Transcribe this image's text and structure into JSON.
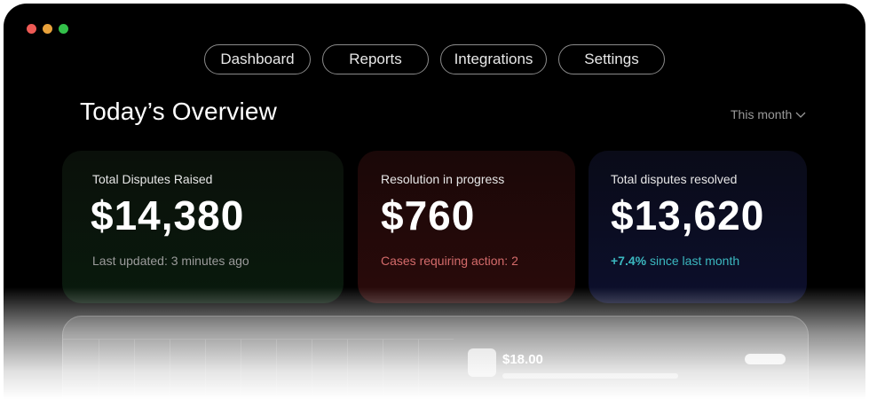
{
  "window": {
    "controls": [
      {
        "name": "close",
        "color": "#ee5a55"
      },
      {
        "name": "minimize",
        "color": "#e9a23b"
      },
      {
        "name": "maximize",
        "color": "#33c04a"
      }
    ]
  },
  "nav": {
    "items": [
      {
        "label": "Dashboard"
      },
      {
        "label": "Reports"
      },
      {
        "label": "Integrations"
      },
      {
        "label": "Settings"
      }
    ]
  },
  "overview": {
    "title": "Today’s Overview",
    "period": "This month"
  },
  "cards": [
    {
      "label": "Total Disputes Raised",
      "value": "$14,380",
      "foot": "Last updated: 3 minutes ago"
    },
    {
      "label": "Resolution in progress",
      "value": "$760",
      "foot": "Cases requiring action: 2"
    },
    {
      "label": "Total disputes resolved",
      "value": "$13,620",
      "foot_pct": "+7.4%",
      "foot_rest": " since last month"
    }
  ],
  "panel": {
    "amount": "$18.00"
  }
}
